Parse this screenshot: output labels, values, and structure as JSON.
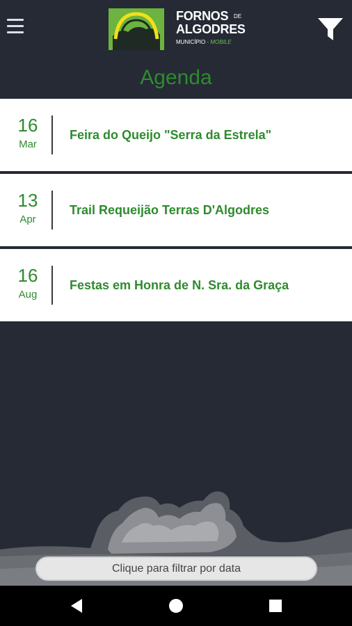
{
  "header": {
    "logo_line1": "FORNOS",
    "logo_de": "DE",
    "logo_line2": "ALGODRES",
    "logo_sub": "MUNICÍPIO",
    "logo_mobile": "MOBILE",
    "menu_icon": "hamburger-menu-icon",
    "filter_icon": "funnel-filter-icon"
  },
  "page_title": "Agenda",
  "events": [
    {
      "day": "16",
      "month": "Mar",
      "title": "Feira do Queijo \"Serra da Estrela\""
    },
    {
      "day": "13",
      "month": "Apr",
      "title": "Trail Requeijão Terras D'Algodres"
    },
    {
      "day": "16",
      "month": "Aug",
      "title": "Festas em Honra de N. Sra. da Graça"
    }
  ],
  "filter_bar": {
    "label": "Clique para filtrar por data"
  },
  "navbar": {
    "back_icon": "back-triangle-icon",
    "home_icon": "home-circle-icon",
    "recents_icon": "recents-square-icon"
  },
  "colors": {
    "accent": "#2e8b2e",
    "background": "#252a35",
    "card": "#ffffff"
  }
}
